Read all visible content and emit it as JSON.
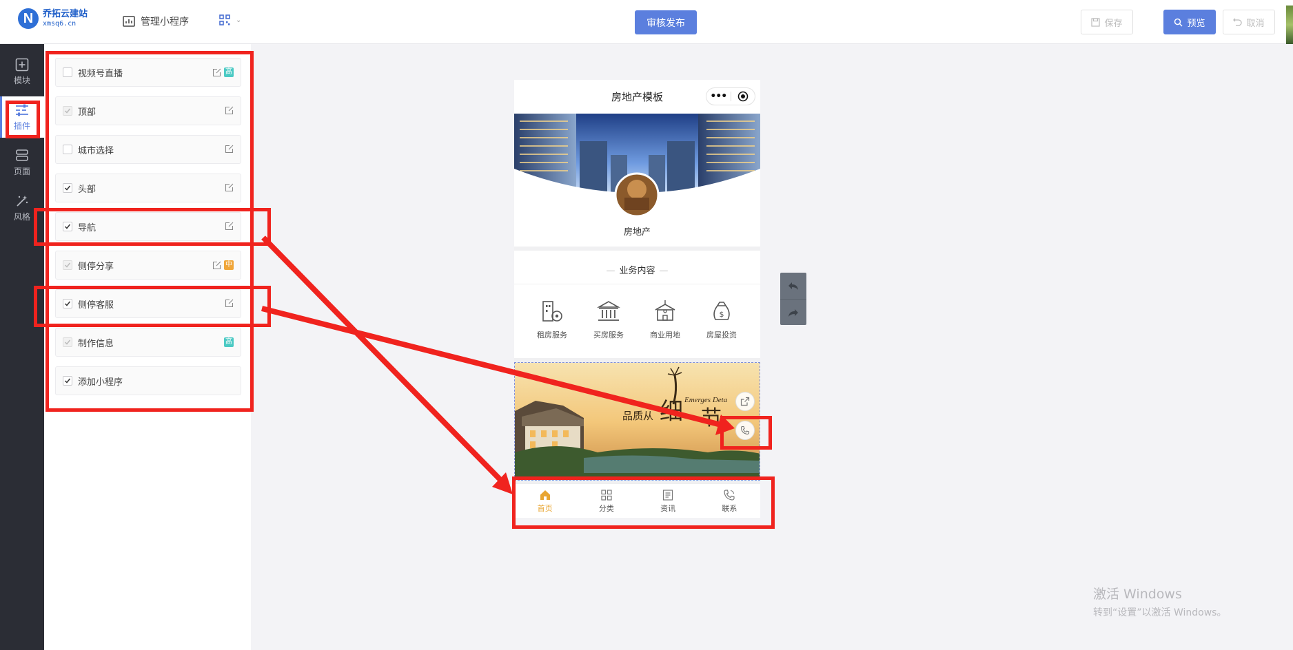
{
  "header": {
    "logo_letter": "N",
    "logo_name": "乔拓云建站",
    "logo_url": "xmsq6.cn",
    "manage_label": "管理小程序",
    "publish_label": "审核发布",
    "save_label": "保存",
    "preview_label": "预览",
    "cancel_label": "取消"
  },
  "iconbar": {
    "items": [
      {
        "label": "模块",
        "icon": "plus-square-icon"
      },
      {
        "label": "插件",
        "icon": "sliders-icon"
      },
      {
        "label": "页面",
        "icon": "pages-icon"
      },
      {
        "label": "风格",
        "icon": "magic-wand-icon"
      }
    ],
    "active": "插件"
  },
  "plugins": [
    {
      "label": "视频号直播",
      "checked": false,
      "badge": "高",
      "badge_type": "high"
    },
    {
      "label": "顶部",
      "checked": true,
      "locked": true
    },
    {
      "label": "城市选择",
      "checked": false
    },
    {
      "label": "头部",
      "checked": true
    },
    {
      "label": "导航",
      "checked": true
    },
    {
      "label": "侧停分享",
      "checked": true,
      "locked": true,
      "badge": "中",
      "badge_type": "mid"
    },
    {
      "label": "侧停客服",
      "checked": true
    },
    {
      "label": "制作信息",
      "checked": true,
      "locked": true,
      "badge": "高",
      "badge_type": "high"
    },
    {
      "label": "添加小程序",
      "checked": true
    }
  ],
  "phone": {
    "title": "房地产模板",
    "shop_name": "房地产",
    "section_title": "业务内容",
    "categories": [
      {
        "label": "租房服务",
        "icon": "building-key-icon"
      },
      {
        "label": "买房服务",
        "icon": "bank-icon"
      },
      {
        "label": "商业用地",
        "icon": "school-icon"
      },
      {
        "label": "房屋投资",
        "icon": "money-bag-icon"
      }
    ],
    "banner_text": "品质从",
    "banner_en": "Emerges Deta",
    "tabs": [
      {
        "label": "首页",
        "icon": "home-icon",
        "active": true
      },
      {
        "label": "分类",
        "icon": "grid-icon"
      },
      {
        "label": "资讯",
        "icon": "news-icon"
      },
      {
        "label": "联系",
        "icon": "phone-icon"
      }
    ]
  },
  "watermark": {
    "line1": "激活 Windows",
    "line2": "转到“设置”以激活 Windows。"
  },
  "colors": {
    "accent": "#5b7fde",
    "sidebar_bg": "#2b2d35",
    "annotation_red": "#f0231e",
    "tab_active": "#e8a531"
  }
}
